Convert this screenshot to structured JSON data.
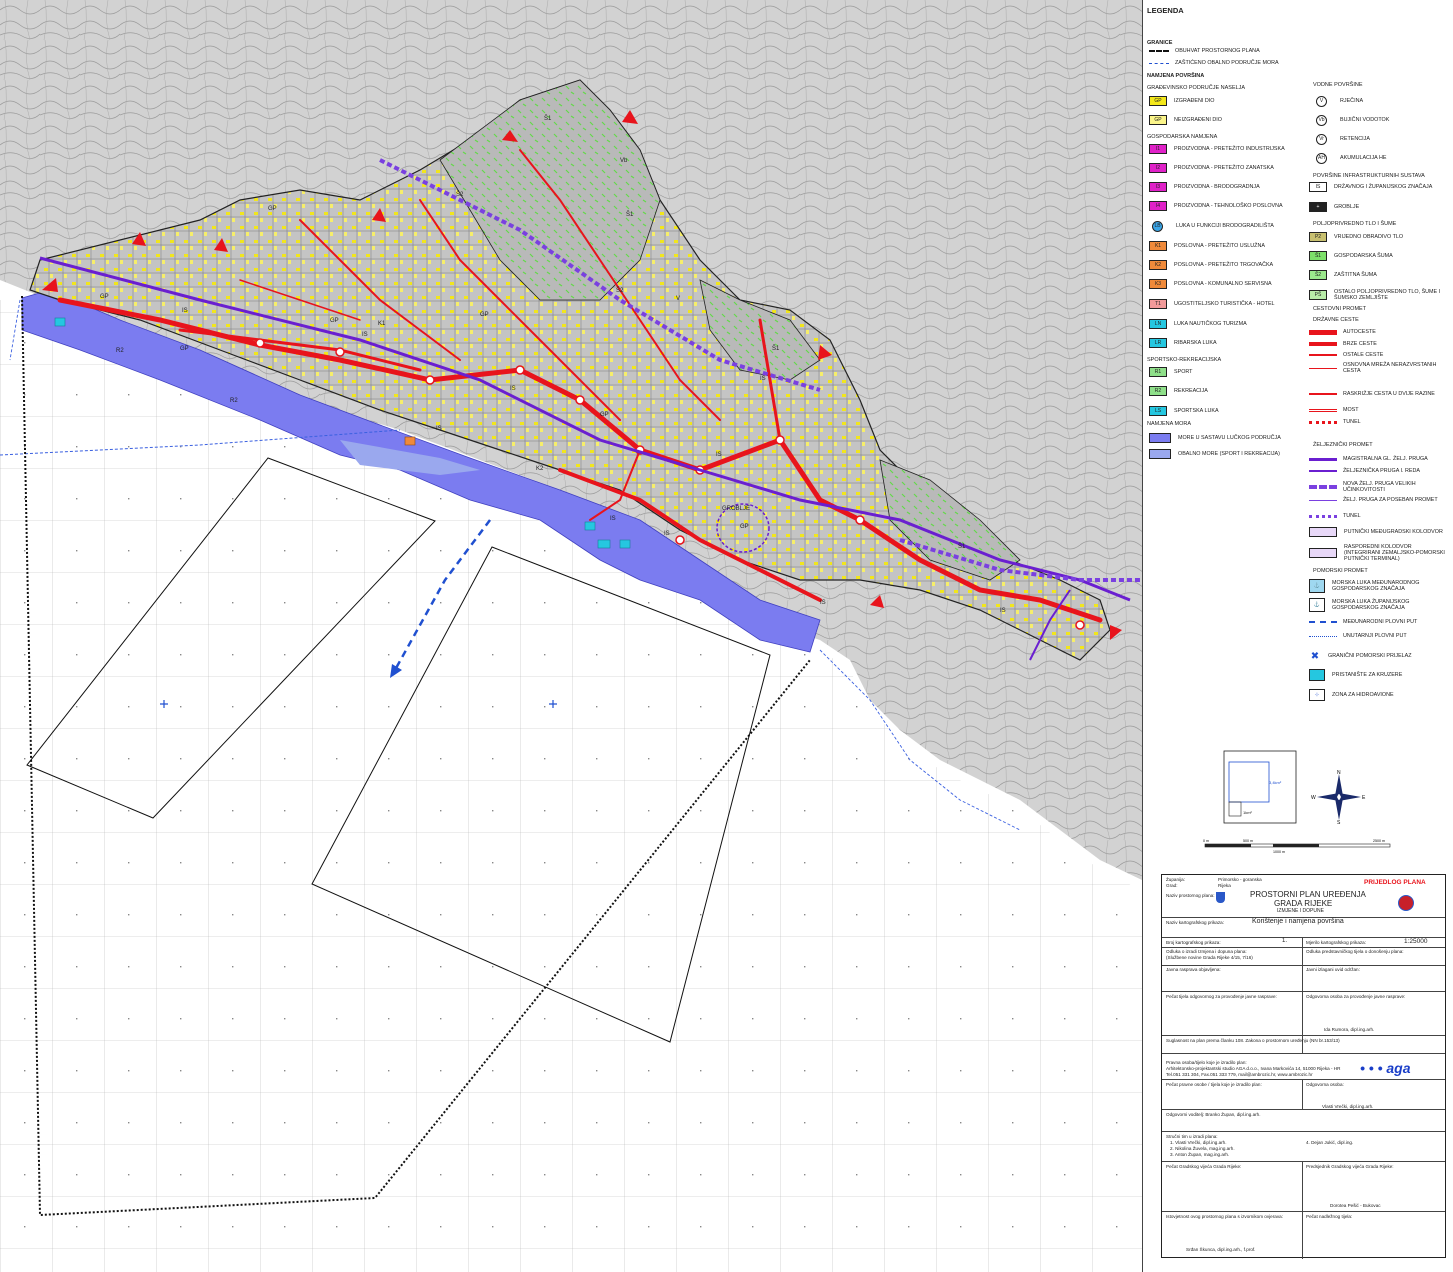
{
  "legend": {
    "title": "LEGENDA",
    "granice": {
      "heading": "GRANICE",
      "items": [
        "OBUHVAT PROSTORNOG PLANA",
        "ZAŠTIĆENO OBALNO PODRUČJE MORA"
      ]
    },
    "namjena": {
      "heading": "NAMJENA POVRŠINA",
      "sub_naselja": "GRAĐEVINSKO PODRUČJE NASELJA",
      "naselja_items": [
        {
          "code": "GP",
          "label": "IZGRAĐENI DIO",
          "color": "#f4e81a"
        },
        {
          "code": "GP",
          "label": "NEIZGRAĐENI DIO",
          "color": "#fbf58a"
        }
      ],
      "sub_gospodarska": "GOSPODARSKA NAMJENA",
      "gospodarska_items": [
        {
          "code": "I1",
          "label": "PROIZVODNA - PRETEŽITO INDUSTRIJSKA",
          "color": "#e021c8"
        },
        {
          "code": "I2",
          "label": "PROIZVODNA - PRETEŽITO ZANATSKA",
          "color": "#e021c8"
        },
        {
          "code": "I3",
          "label": "PROIZVODNA - BRODOGRADNJA",
          "color": "#e021c8"
        },
        {
          "code": "I4",
          "label": "PROIZVODNA - TEHNOLOŠKO POSLOVNA",
          "color": "#e021c8"
        },
        {
          "code": "LB",
          "label": "LUKA U FUNKCIJI BRODOGRADILIŠTA",
          "color": "#3aa6e8"
        },
        {
          "code": "K1",
          "label": "POSLOVNA - PRETEŽITO USLUŽNA",
          "color": "#f08a3a"
        },
        {
          "code": "K2",
          "label": "POSLOVNA - PRETEŽITO TRGOVAČKA",
          "color": "#f08a3a"
        },
        {
          "code": "K3",
          "label": "POSLOVNA - KOMUNALNO SERVISNA",
          "color": "#f08a3a"
        },
        {
          "code": "T1",
          "label": "UGOSTITELJSKO TURISTIČKA - HOTEL",
          "color": "#f29a9a"
        },
        {
          "code": "LN",
          "label": "LUKA NAUTIČKOG TURIZMA",
          "color": "#25c7e0"
        },
        {
          "code": "LR",
          "label": "RIBARSKA LUKA",
          "color": "#25c7e0"
        }
      ],
      "sub_sport": "SPORTSKO-REKREACIJSKA",
      "sport_items": [
        {
          "code": "R1",
          "label": "SPORT",
          "color": "#8fe08a"
        },
        {
          "code": "R2",
          "label": "REKREACIJA",
          "color": "#8fe08a"
        },
        {
          "code": "LS",
          "label": "SPORTSKA LUKA",
          "color": "#25c7e0"
        }
      ],
      "sub_mora": "NAMJENA MORA",
      "mora_items": [
        {
          "label": "MORE U SASTAVU LUČKOG PODRUČJA",
          "color": "#7b7cf0"
        },
        {
          "label": "OBALNO MORE (SPORT I REKREACIJA)",
          "color": "#9aa8ee"
        }
      ]
    },
    "vodne": {
      "heading": "VODNE POVRŠINE",
      "items": [
        {
          "code": "V",
          "label": "RJEČINA"
        },
        {
          "code": "Vb",
          "label": "BUJIČNI VODOTOK"
        },
        {
          "code": "Vr",
          "label": "RETENCIJA"
        },
        {
          "code": "AH",
          "label": "AKUMULACIJA HE"
        }
      ]
    },
    "infra": {
      "heading": "POVRŠINE INFRASTRUKTURNIH SUSTAVA",
      "items": [
        {
          "code": "IS",
          "label": "DRŽAVNOG I ŽUPANIJSKOG ZNAČAJA"
        },
        {
          "code": "+",
          "label": "GROBLJE"
        }
      ]
    },
    "poljo": {
      "heading": "POLJOPRIVREDNO TLO I ŠUME",
      "items": [
        {
          "code": "P2",
          "label": "VRIJEDNO OBRADIVO TLO",
          "color": "#c8c070"
        },
        {
          "code": "Š1",
          "label": "GOSPODARSKA ŠUMA",
          "color": "#7de06a"
        },
        {
          "code": "Š2",
          "label": "ZAŠTITNA ŠUMA",
          "color": "#9be88c"
        },
        {
          "code": "PŠ",
          "label": "OSTALO POLJOPRIVREDNO TLO, ŠUME I ŠUMSKO ZEMLJIŠTE",
          "color": "#b8eca8"
        }
      ]
    },
    "promet": {
      "heading": "CESTOVNI PROMET",
      "sub_drzavne": "DRŽAVNE CESTE",
      "ceste_items": [
        "AUTOCESTE",
        "BRZE CESTE",
        "OSTALE CESTE",
        "OSNOVNA MREŽA NERAZVRSTANIH CESTA",
        "RASKRIŽJE CESTA U DVIJE RAZINE",
        "MOST",
        "TUNEL"
      ],
      "sub_zeljeznicki": "ŽELJEZNIČKI PROMET",
      "zeljeznicki_items": [
        "MAGISTRALNA GL. ŽELJ. PRUGA",
        "ŽELJEZNIČKA PRUGA I. REDA",
        "NOVA ŽELJ. PRUGA VELIKIH UČINKOVITOSTI",
        "ŽELJ. PRUGA ZA POSEBAN PROMET",
        "TUNEL",
        "PUTNIČKI MEĐUGRADSKI KOLODVOR",
        "RASPOREDNI KOLODVOR (INTEGRIRANI ZEMALJSKO-POMORSKI PUTNIČKI TERMINAL)"
      ],
      "sub_pomorski": "POMORSKI PROMET",
      "pomorski_items": [
        "MORSKA LUKA MEĐUNARODNOG GOSPODARSKOG ZNAČAJA",
        "MORSKA LUKA ŽUPANIJSKOG GOSPODARSKOG ZNAČAJA",
        "MEĐUNARODNI PLOVNI PUT",
        "UNUTARNJI PLOVNI PUT",
        "GRANIČNI POMORSKI PRIJELAZ",
        "PRISTANIŠTE ZA KRUZERE",
        "ZONA ZA HIDROAVIONE"
      ]
    },
    "inset": {
      "area1": "3,4km²",
      "area2": "1km²"
    },
    "compass": {
      "n": "N",
      "s": "S",
      "e": "E",
      "w": "W"
    },
    "scalebar": {
      "labels": [
        "0 m",
        "500 m",
        "1000 m",
        "2500 m"
      ]
    }
  },
  "titleblock": {
    "zupanija_label": "Županija:",
    "zupanija_value": "Primorsko - goranska",
    "grad_label": "Grad:",
    "grad_value": "Rijeka",
    "naziv_label": "Naziv prostornog plana:",
    "prijedlog": "PRIJEDLOG PLANA",
    "plan_title_1": "PROSTORNI PLAN UREĐENJA",
    "plan_title_2": "GRADA RIJEKE",
    "plan_subtitle": "IZMJENE I DOPUNE",
    "kartografski_label": "Naziv kartografskog prikaza:",
    "kartografski_value": "Korištenje i namjena površina",
    "broj_label": "Broj kartografskog prikaza:",
    "broj_value": "1.",
    "mjerilo_label": "Mjerilo kartografskog prikaza:",
    "mjerilo_value": "1:25000",
    "odluka_label": "Odluka o izradi Izmjena i dopuna plana:",
    "odluka_value": "(Službene novine Grada Rijeke 4/15, 7/16)",
    "donosenju_label": "Odluka predstavničkog tijela o donošenju plana:",
    "javna_rasprava": "Javna rasprava objavljena:",
    "javni_uvid": "Javni izlagani uvid održan:",
    "pecat_jedinica": "Pečat tijela odgovornog za provođenje javne rasprave:",
    "odgovorna_osoba": "Odgovorna osoba za provođenje javne rasprave:",
    "odgovorna_ime": "Ida Rumora, dipl.ing.arh.",
    "suglasnost": "Suglasnost na plan prema članku 108. Zakona o prostornom uređenju (NN br.153/13)",
    "izradjivac_label": "Pravna osoba/tijelo koje je izradilo plan:",
    "izradjivac_value": "Arhitektonsko-projektantski studio AGA d.o.o., Ivana Markovića 14, 51000 Rijeka - HR",
    "izradjivac_contact": "Tel.051 331 304, Fax.051 333 779, mail@ambrozic.hr, www.ambrozic.hr",
    "pecat_izradjivac": "Pečat pravne osobe / tijela koje je izradilo plan:",
    "odgovorna_osoba_2": "Odgovorna osoba:",
    "odgovorna_ime_2": "Vlasti Vrečki, dipl.ing.arh.",
    "koordinator": "Odgovorni voditelj: Branko Župan, dipl.ing.arh.",
    "strucni_tim_label": "Stručni tim u izradi plana:",
    "strucni_tim": [
      "1. Vlasti Vrečki, dipl.ing.arh.",
      "2. Nikolina Žuvela, mag.ing.arh.",
      "3. Anton Župan, mag.ing.arh.",
      "4. Dejan Jukić, dipl.ing."
    ],
    "pecat_vijece": "Pečat Gradskog vijeća Grada Rijeke:",
    "predsjednik": "Predsjednik Gradskog vijeća Grada Rijeke:",
    "predsjednik_ime": "Dorotea Pešić - Bukovac",
    "istovjetnost": "Istovjetnost ovog prostornog plana s izvornikom ovjerava:",
    "istovjetnost_ime": "Srđan Škunca, dipl.ing.arh., f.prof.",
    "pecat_tijela": "Pečat nadležnog tijela:",
    "logo_text": "aga"
  },
  "map": {
    "labels": [
      "GP",
      "GP",
      "GP",
      "GP",
      "GP",
      "GP",
      "GP",
      "IS",
      "IS",
      "IS",
      "IS",
      "IS",
      "IS",
      "IS",
      "IS",
      "IS",
      "IS",
      "Š1",
      "Š1",
      "Š1",
      "Š1",
      "Š2",
      "Š2",
      "K1",
      "K2",
      "R2",
      "R2",
      "V",
      "Vb",
      "GROBLJE"
    ]
  }
}
